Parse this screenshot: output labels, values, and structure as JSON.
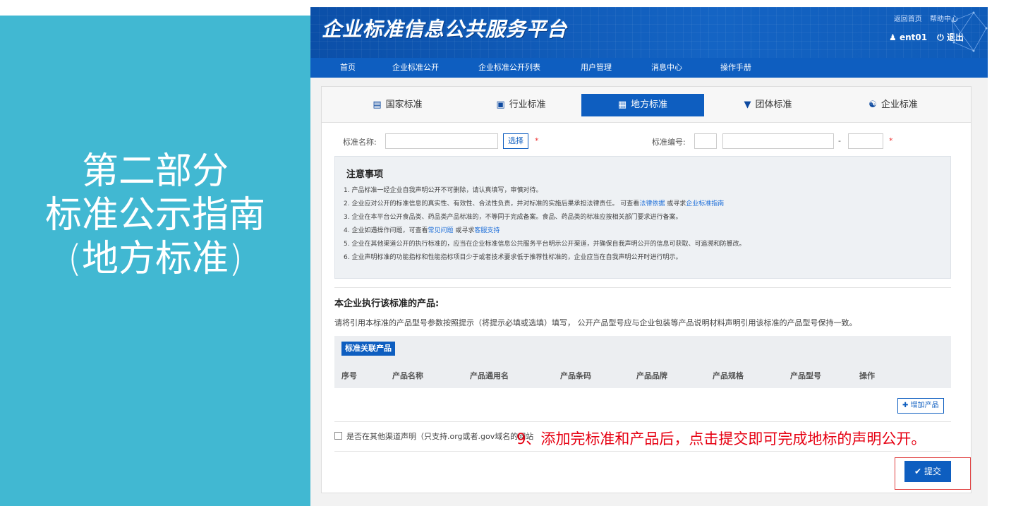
{
  "slide": {
    "title_lines": [
      "第二部分",
      "标准公示指南",
      "(地方标准)"
    ]
  },
  "header": {
    "logo": "企业标准信息公共服务平台",
    "links": [
      "返回首页",
      "帮助中心"
    ],
    "user": "ent01",
    "logout": "退出"
  },
  "nav": [
    "首页",
    "企业标准公开",
    "企业标准公开列表",
    "用户管理",
    "消息中心",
    "操作手册"
  ],
  "tabs": [
    {
      "label": "国家标准",
      "icon": "book-icon"
    },
    {
      "label": "行业标准",
      "icon": "briefcase-icon"
    },
    {
      "label": "地方标准",
      "icon": "document-icon",
      "active": true
    },
    {
      "label": "团体标准",
      "icon": "shield-icon"
    },
    {
      "label": "企业标准",
      "icon": "bank-icon"
    }
  ],
  "form": {
    "name_label": "标准名称:",
    "select_button": "选择",
    "required_mark": "*",
    "number_label": "标准编号:",
    "dash": "-"
  },
  "notice": {
    "title": "注意事项",
    "l1": "1. 产品标准一经企业自我声明公开不可删除，请认真填写，审慎对待。",
    "l2_a": "2. 企业应对公开的标准信息的真实性、有效性、合法性负责，并对标准的实施后果承担法律责任。 可查看",
    "l2_link1": "法律依据",
    "l2_b": " 或寻求",
    "l2_link2": "企业标准指南",
    "l3": "3. 企业在本平台公开食品类、药品类产品标准的，不等同于完成备案。食品、药品类的标准应按相关部门要求进行备案。",
    "l4_a": "4. 企业如遇操作问题，可查看",
    "l4_link1": "常见问题",
    "l4_b": " 或寻求",
    "l4_link2": "客服支持",
    "l5": "5. 企业在其他渠道公开的执行标准的，应当在企业标准信息公共服务平台明示公开渠道，并确保自我声明公开的信息可获取、可追溯和防篡改。",
    "l6": "6. 企业声明标准的功能指标和性能指标项目少于或者技术要求低于推荐性标准的，企业应当在自我声明公开时进行明示。"
  },
  "products": {
    "title": "本企业执行该标准的产品:",
    "desc": "请将引用本标准的产品型号参数按照提示（将提示必填或选填）填写， 公开产品型号应与企业包装等产品说明材料声明引用该标准的产品型号保持一致。",
    "table_tag": "标准关联产品",
    "columns": [
      "序号",
      "产品名称",
      "产品通用名",
      "产品条码",
      "产品品牌",
      "产品规格",
      "产品型号",
      "操作"
    ],
    "add_button": "增加产品"
  },
  "other_channel": "是否在其他渠道声明（只支持.org或者.gov域名的网站",
  "submit_label": "提交",
  "annotation": "9、添加完标准和产品后，点击提交即可完成地标的声明公开。"
}
